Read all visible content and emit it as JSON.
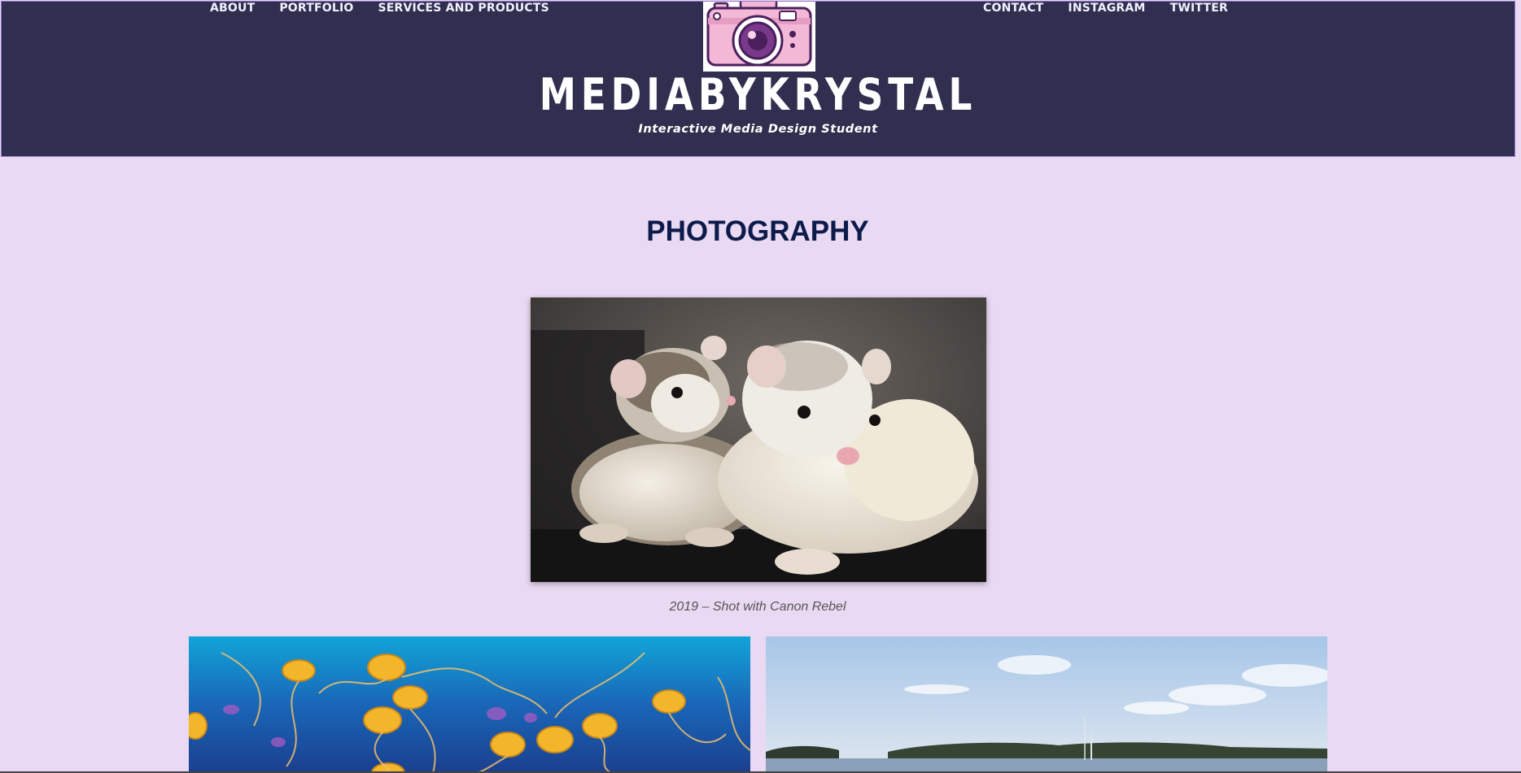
{
  "nav": {
    "left": [
      "ABOUT",
      "PORTFOLIO",
      "SERVICES AND PRODUCTS"
    ],
    "right": [
      "CONTACT",
      "INSTAGRAM",
      "TWITTER"
    ]
  },
  "header": {
    "logo_icon": "camera-icon",
    "site_title": "MEDIABYKRYSTAL",
    "tagline": "Interactive Media Design Student"
  },
  "main": {
    "heading": "PHOTOGRAPHY",
    "featured_caption": "2019 – Shot with Canon Rebel",
    "photos": [
      {
        "subject": "ferrets",
        "icon": "photo-ferrets"
      },
      {
        "subject": "jellyfish",
        "icon": "photo-jellyfish"
      },
      {
        "subject": "bay",
        "icon": "photo-bay"
      }
    ]
  },
  "colors": {
    "header_bg": "#302f4f",
    "page_bg": "#ead9f3",
    "heading": "#0d1b4a",
    "logo_pink": "#f2b8d6",
    "logo_purple": "#4a1f5c"
  }
}
